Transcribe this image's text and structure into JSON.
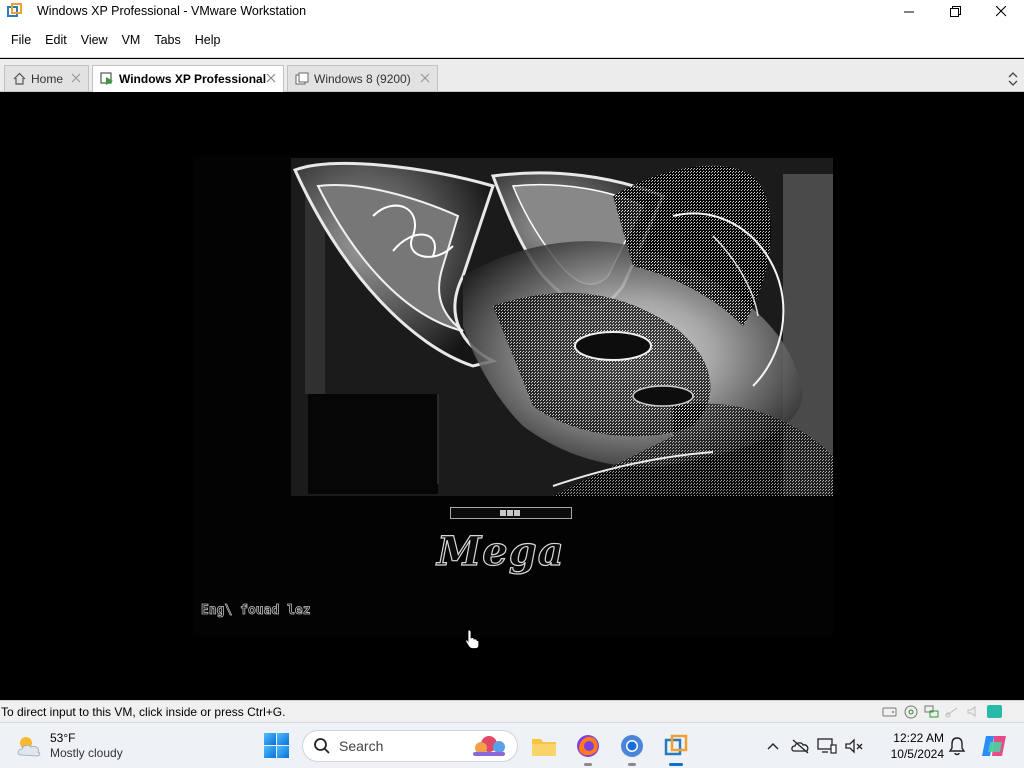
{
  "window": {
    "title": "Windows XP Professional - VMware Workstation"
  },
  "menu": [
    "File",
    "Edit",
    "View",
    "VM",
    "Tabs",
    "Help"
  ],
  "tabs": [
    {
      "label": "Home",
      "icon": "home-icon",
      "active": false
    },
    {
      "label": "Windows XP Professional",
      "icon": "vm-running-icon",
      "active": true
    },
    {
      "label": "Windows 8 (9200)",
      "icon": "vm-icon",
      "active": false
    }
  ],
  "vm": {
    "boot_logo_text": "Mega",
    "boot_credit": "Eng\\ fouad lez"
  },
  "status": {
    "text": "To direct input to this VM, click inside or press Ctrl+G."
  },
  "taskbar": {
    "weather_temp": "53°F",
    "weather_desc": "Mostly cloudy",
    "search_label": "Search",
    "clock_time": "12:22 AM",
    "clock_date": "10/5/2024",
    "apps": [
      "file-explorer-icon",
      "firefox-icon",
      "chrome-icon",
      "vmware-icon"
    ]
  },
  "colors": {
    "accent": "#0a6fd6",
    "vmware_blue": "#2a7abf",
    "vmware_orange": "#f0a030"
  }
}
